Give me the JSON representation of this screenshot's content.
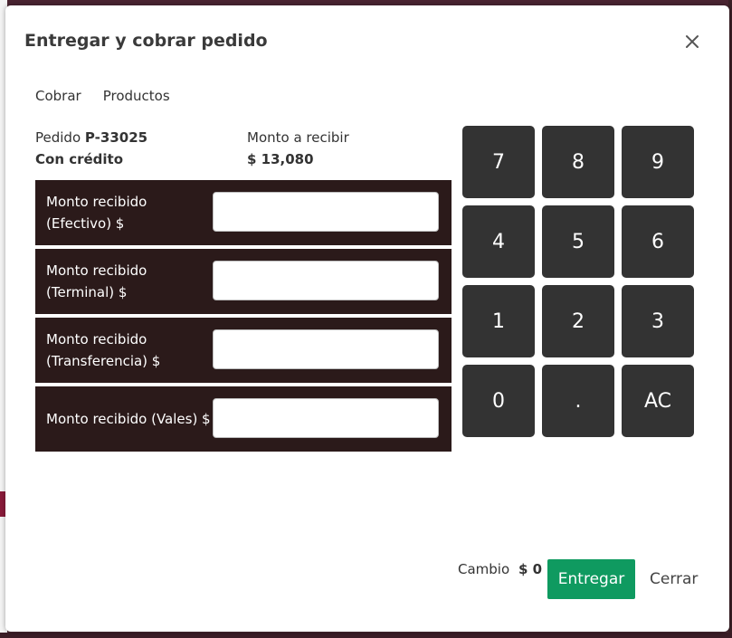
{
  "modal": {
    "title": "Entregar y cobrar pedido"
  },
  "tabs": [
    {
      "label": "Cobrar"
    },
    {
      "label": "Productos"
    }
  ],
  "order": {
    "prefix": "Pedido",
    "id": "P-33025",
    "credit": "Con crédito"
  },
  "amount": {
    "label": "Monto a recibir",
    "value": "$ 13,080"
  },
  "payments": [
    {
      "label": "Monto recibido (Efectivo) $",
      "value": ""
    },
    {
      "label": "Monto recibido (Terminal) $",
      "value": ""
    },
    {
      "label": "Monto recibido (Transferencia) $",
      "value": ""
    },
    {
      "label": "Monto recibido (Vales) $",
      "value": ""
    }
  ],
  "keypad": {
    "keys": [
      "7",
      "8",
      "9",
      "4",
      "5",
      "6",
      "1",
      "2",
      "3",
      "0",
      ".",
      "AC"
    ]
  },
  "footer": {
    "change_label": "Cambio",
    "change_value": "$ 0",
    "deliver_label": "Entregar",
    "close_label": "Cerrar"
  },
  "colors": {
    "accent": "#0f9a60",
    "row_bg": "#2b1a1a",
    "key_bg": "#333333"
  },
  "icons": {
    "close": "close-icon"
  }
}
